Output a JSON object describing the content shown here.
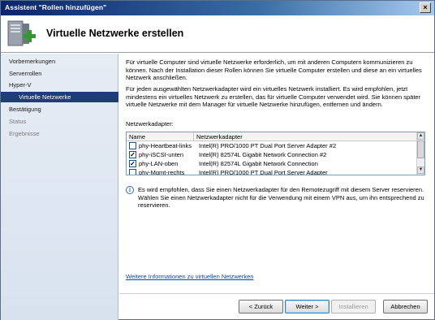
{
  "window": {
    "title": "Assistent \"Rollen hinzufügen\"",
    "close_glyph": "×"
  },
  "header": {
    "title": "Virtuelle Netzwerke erstellen",
    "icon": "server-roles-add-icon"
  },
  "sidebar": {
    "items": [
      {
        "label": "Vorbemerkungen"
      },
      {
        "label": "Serverrollen"
      },
      {
        "label": "Hyper-V"
      },
      {
        "label": "Virtuelle Netzwerke"
      },
      {
        "label": "Bestätigung"
      },
      {
        "label": "Status"
      },
      {
        "label": "Ergebnisse"
      }
    ]
  },
  "content": {
    "para1": "Für virtuelle Computer sind virtuelle Netzwerke erforderlich, um mit anderen Computern kommunizieren zu können. Nach der Installation dieser Rollen können Sie virtuelle Computer erstellen und diese an ein virtuelles Netzwerk anschließen.",
    "para2": "Für jeden ausgewählten Netzwerkadapter wird ein virtuelles Netzwerk installiert. Es wird empfohlen, jetzt mindestens ein virtuelles Netzwerk zu erstellen, das für virtuelle Computer verwendet wird. Sie können später virtuelle Netzwerke mit dem Manager für virtuelle Netzwerke hinzufügen, entfernen und ändern.",
    "adapters_label": "Netzwerkadapter:",
    "table": {
      "headers": [
        "Name",
        "Netzwerkadapter"
      ],
      "rows": [
        {
          "name": "phy-Heartbeat-links",
          "adapter": "Intel(R) PRO/1000 PT Dual Port Server Adapter #2",
          "check": ""
        },
        {
          "name": "phy-iSCSI-unten",
          "adapter": "Intel(R) 82574L Gigabit Network Connection #2",
          "check": "✓"
        },
        {
          "name": "phy-LAN-oben",
          "adapter": "Intel(R) 82574L Gigabit Network Connection",
          "check": "✓"
        },
        {
          "name": "phy-Mgmt-rechts",
          "adapter": "Intel(R) PRO/1000 PT Dual Port Server Adapter",
          "check": ""
        }
      ],
      "scroll_up": "▲",
      "scroll_down": "▼"
    },
    "info_glyph": "i",
    "info_text": "Es wird empfohlen, dass Sie einen Netzwerkadapter für den Remotezugriff mit diesem Server reservieren. Wählen Sie einen Netzwerkadapter nicht für die Verwendung mit einem VPN aus, um ihn entsprechend zu reservieren.",
    "link": "Weitere Informationen zu virtuellen Netzwerken"
  },
  "buttons": {
    "back": "< Zurück",
    "next": "Weiter >",
    "install": "Installieren",
    "cancel": "Abbrechen"
  }
}
